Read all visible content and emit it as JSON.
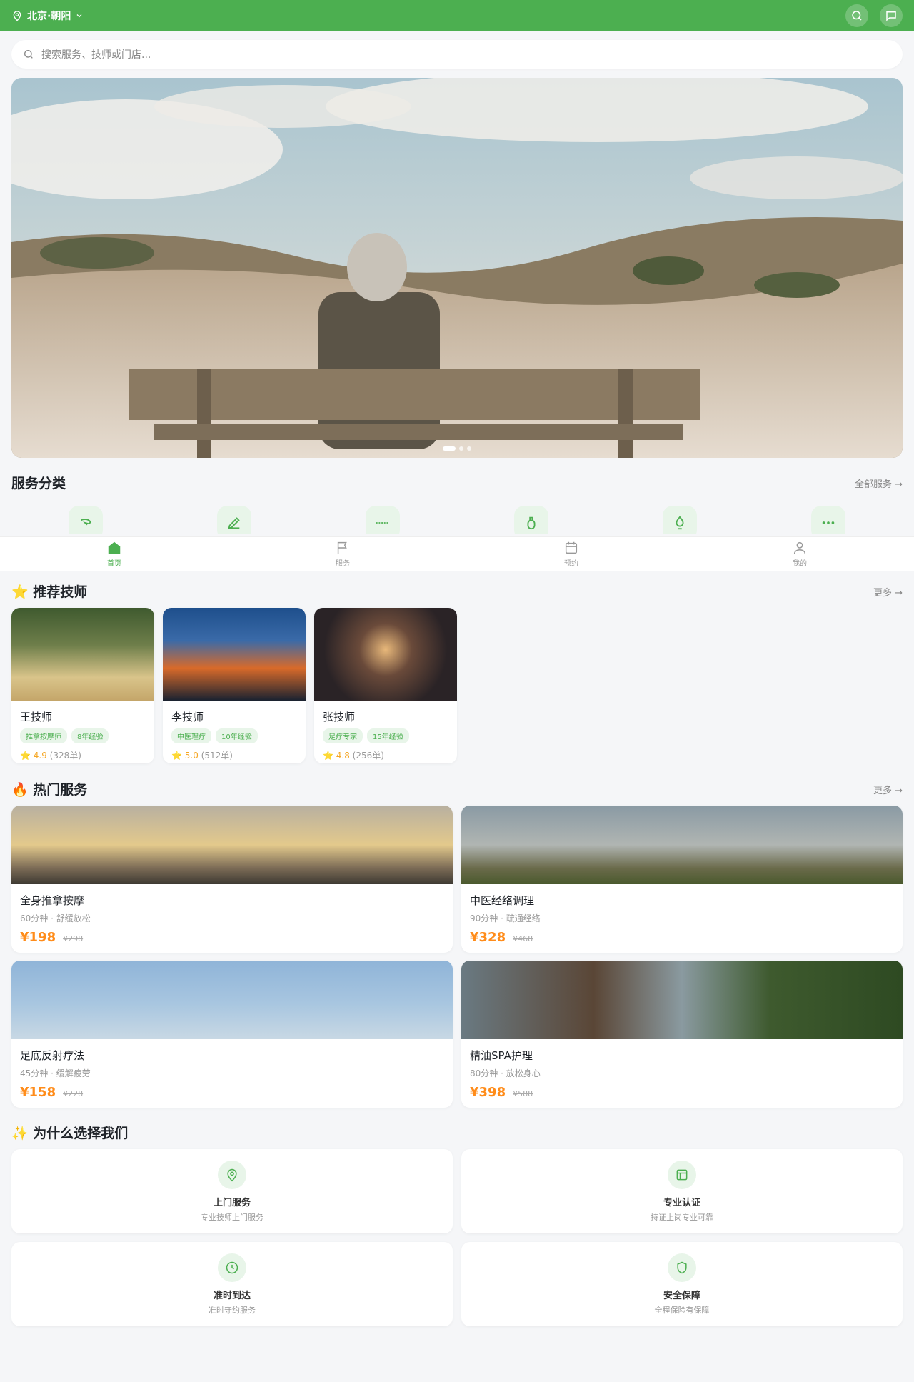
{
  "header": {
    "location": "北京·朝阳"
  },
  "search": {
    "placeholder": "搜索服务、技师或门店..."
  },
  "banner": {
    "dots": 3
  },
  "categories": {
    "title": "服务分类",
    "more": "全部服务 →"
  },
  "tabbar": [
    {
      "label": "首页",
      "icon": "home-icon"
    },
    {
      "label": "服务",
      "icon": "flag-icon"
    },
    {
      "label": "预约",
      "icon": "calendar-icon"
    },
    {
      "label": "我的",
      "icon": "user-icon"
    }
  ],
  "therapists": {
    "title": "⭐ 推荐技师",
    "more": "更多 →",
    "items": [
      {
        "name": "王技师",
        "tags": [
          "推拿按摩师",
          "8年经验"
        ],
        "score": "⭐ 4.9",
        "count": "(328单)"
      },
      {
        "name": "李技师",
        "tags": [
          "中医理疗",
          "10年经验"
        ],
        "score": "⭐ 5.0",
        "count": "(512单)"
      },
      {
        "name": "张技师",
        "tags": [
          "足疗专家",
          "15年经验"
        ],
        "score": "⭐ 4.8",
        "count": "(256单)"
      }
    ]
  },
  "services": {
    "title": "🔥 热门服务",
    "more": "更多 →",
    "items": [
      {
        "name": "全身推拿按摩",
        "meta": "60分钟 · 舒缓放松",
        "price": "¥198",
        "orig": "¥298"
      },
      {
        "name": "中医经络调理",
        "meta": "90分钟 · 疏通经络",
        "price": "¥328",
        "orig": "¥468"
      },
      {
        "name": "足底反射疗法",
        "meta": "45分钟 · 缓解疲劳",
        "price": "¥158",
        "orig": "¥228"
      },
      {
        "name": "精油SPA护理",
        "meta": "80分钟 · 放松身心",
        "price": "¥398",
        "orig": "¥588"
      }
    ]
  },
  "features": {
    "title": "✨ 为什么选择我们",
    "items": [
      {
        "title": "上门服务",
        "desc": "专业技师上门服务",
        "icon": "location-icon"
      },
      {
        "title": "专业认证",
        "desc": "持证上岗专业可靠",
        "icon": "certificate-icon"
      },
      {
        "title": "准时到达",
        "desc": "准时守约服务",
        "icon": "clock-icon"
      },
      {
        "title": "安全保障",
        "desc": "全程保险有保障",
        "icon": "shield-icon"
      }
    ]
  },
  "colors": {
    "brand": "#4caf50",
    "price": "#ff8c1a",
    "rating": "#f5a623"
  }
}
